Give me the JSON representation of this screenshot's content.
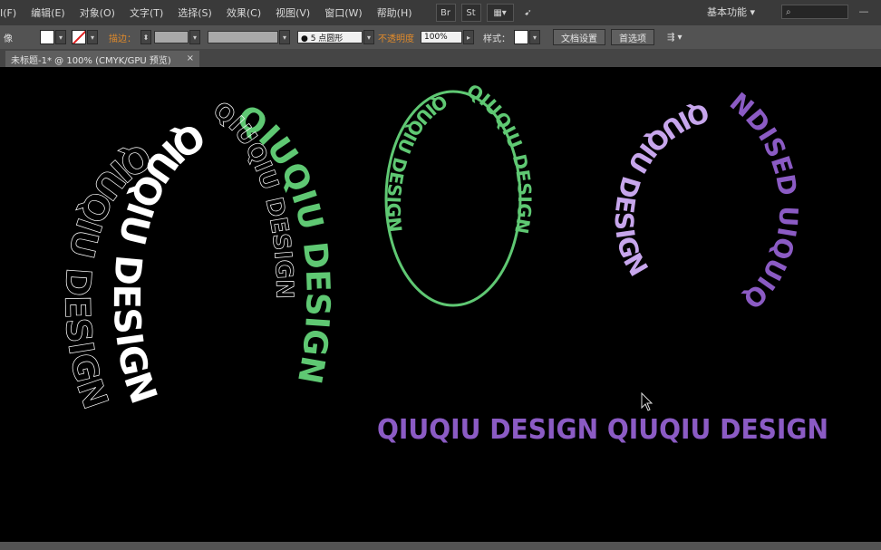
{
  "menu": [
    "I(F)",
    "编辑(E)",
    "对象(O)",
    "文字(T)",
    "选择(S)",
    "效果(C)",
    "视图(V)",
    "窗口(W)",
    "帮助(H)"
  ],
  "toolbar_icons": [
    "Br",
    "St",
    "▦▾",
    "➹"
  ],
  "workspace_label": "基本功能 ▾",
  "search_glyph": "⌕",
  "window_controls": [
    "—",
    "☐",
    "✕"
  ],
  "control": {
    "left_label": "像",
    "stroke_label": "描边：",
    "points_label": "● 5 点圆形",
    "opacity_label": "不透明度",
    "opacity_value": "100%",
    "style_label": "样式：",
    "doc_setup": "文档设置",
    "preferences": "首选项"
  },
  "tab": {
    "title": "未标题-1* @ 100% (CMYK/GPU 预览)",
    "close": "×"
  },
  "colors": {
    "green": "#5fc873",
    "purple": "#8b5bc4",
    "white": "#ffffff"
  },
  "artwork": {
    "tagline": "QIUQIU DESIGN QIUQIU DESIGN",
    "ring_text": "QIUQIU DESIGN",
    "ring_text_reverse": "NDISED UIQUIQ"
  }
}
